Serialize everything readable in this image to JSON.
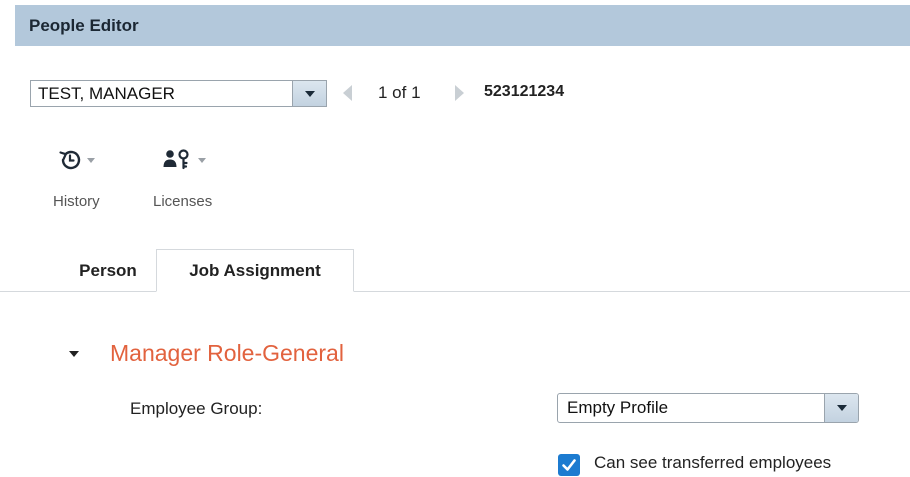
{
  "window": {
    "title": "People Editor"
  },
  "person_select": {
    "value": "TEST, MANAGER"
  },
  "pager": {
    "count": "1 of 1"
  },
  "employee_id": "523121234",
  "toolbar": {
    "history": {
      "label": "History",
      "icon": "history-icon"
    },
    "licenses": {
      "label": "Licenses",
      "icon": "licenses-icon"
    }
  },
  "tabs": [
    {
      "label": "Person",
      "active": false
    },
    {
      "label": "Job Assignment",
      "active": true
    }
  ],
  "section": {
    "title": "Manager Role-General",
    "color": "#e2623e",
    "employee_group": {
      "label": "Employee Group:",
      "value": "Empty Profile"
    },
    "transferred": {
      "label": "Can see transferred employees",
      "checked": true
    }
  },
  "colors": {
    "titlebar": "#b3c8db",
    "checkbox": "#1c7bd0"
  }
}
